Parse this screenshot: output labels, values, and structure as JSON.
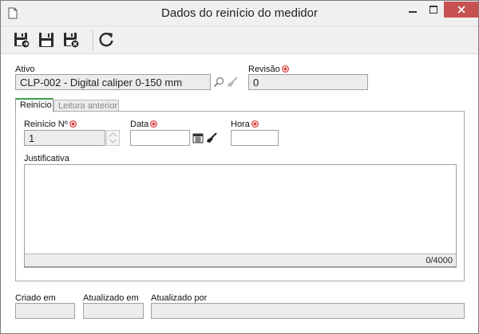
{
  "window": {
    "title": "Dados do reinício do medidor"
  },
  "toolbar": {
    "buttons": [
      {
        "name": "save-and-new",
        "icon": "save-new-icon"
      },
      {
        "name": "save",
        "icon": "save-icon"
      },
      {
        "name": "save-and-close",
        "icon": "save-close-icon"
      },
      {
        "name": "refresh",
        "icon": "refresh-icon"
      }
    ]
  },
  "form": {
    "ativo_label": "Ativo",
    "ativo_value": "CLP-002 - Digital caliper 0-150 mm",
    "revisao_label": "Revisão",
    "revisao_value": "0"
  },
  "tabs": [
    {
      "label": "Reinício",
      "active": true
    },
    {
      "label": "Leitura anterior",
      "active": false
    }
  ],
  "reinicio": {
    "numero_label": "Reinício Nº",
    "numero_value": "1",
    "data_label": "Data",
    "data_value": "",
    "hora_label": "Hora",
    "hora_value": "",
    "justificativa_label": "Justificativa",
    "justificativa_value": "",
    "counter": "0/4000"
  },
  "footer": {
    "criado_em_label": "Criado em",
    "criado_em_value": "",
    "atualizado_em_label": "Atualizado em",
    "atualizado_em_value": "",
    "atualizado_por_label": "Atualizado por",
    "atualizado_por_value": ""
  },
  "colors": {
    "required": "#d42020",
    "tab_accent": "#3aa04a",
    "close_button": "#c75050"
  }
}
